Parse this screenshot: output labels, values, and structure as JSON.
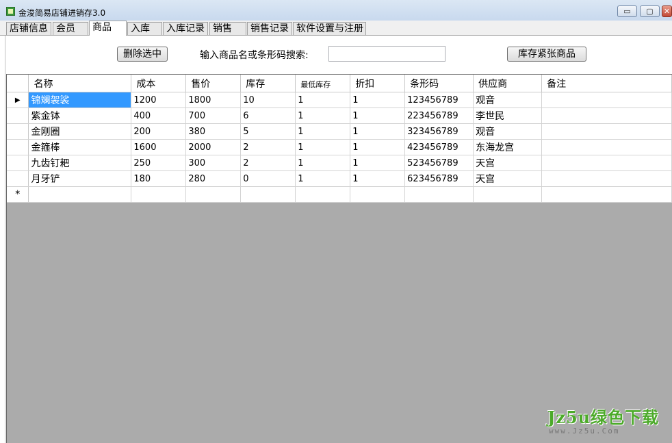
{
  "window": {
    "title": "金浚简易店铺进销存3.0",
    "minimize_glyph": "▭",
    "maximize_glyph": "▢",
    "close_glyph": "✕"
  },
  "tabs": [
    {
      "label": "店铺信息"
    },
    {
      "label": "会员"
    },
    {
      "label": "商品",
      "active": true
    },
    {
      "label": "入库"
    },
    {
      "label": "入库记录"
    },
    {
      "label": "销售"
    },
    {
      "label": "销售记录"
    },
    {
      "label": "软件设置与注册"
    }
  ],
  "toolbar": {
    "delete_label": "删除选中",
    "search_label": "输入商品名或条形码搜索:",
    "search_value": "",
    "low_stock_label": "库存紧张商品"
  },
  "grid": {
    "columns": [
      "名称",
      "成本",
      "售价",
      "库存",
      "最低库存",
      "折扣",
      "条形码",
      "供应商",
      "备注"
    ],
    "rows": [
      {
        "marker": "▶",
        "cells": [
          "锦斓袈裟",
          "1200",
          "1800",
          "10",
          "1",
          "1",
          "123456789",
          "观音",
          ""
        ]
      },
      {
        "marker": "",
        "cells": [
          "紫金钵",
          "400",
          "700",
          "6",
          "1",
          "1",
          "223456789",
          "李世民",
          ""
        ]
      },
      {
        "marker": "",
        "cells": [
          "金刚圈",
          "200",
          "380",
          "5",
          "1",
          "1",
          "323456789",
          "观音",
          ""
        ]
      },
      {
        "marker": "",
        "cells": [
          "金箍棒",
          "1600",
          "2000",
          "2",
          "1",
          "1",
          "423456789",
          "东海龙宫",
          ""
        ]
      },
      {
        "marker": "",
        "cells": [
          "九齿钉耙",
          "250",
          "300",
          "2",
          "1",
          "1",
          "523456789",
          "天宫",
          ""
        ]
      },
      {
        "marker": "",
        "cells": [
          "月牙铲",
          "180",
          "280",
          "0",
          "1",
          "1",
          "623456789",
          "天宫",
          ""
        ]
      }
    ],
    "new_row_marker": "*",
    "selected_cell_color": "#3399ff",
    "empty_area_color": "#ababab"
  },
  "watermark": {
    "main": "Jz5u绿色下载",
    "sub": "www.Jz5u.Com"
  }
}
